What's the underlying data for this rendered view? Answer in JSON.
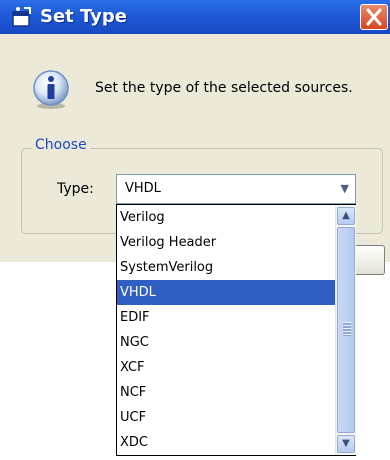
{
  "dialog": {
    "title": "Set Type",
    "message": "Set the type of the selected sources.",
    "group_label": "Choose",
    "type_label": "Type:",
    "selected_type": "VHDL"
  },
  "dropdown": {
    "options": [
      {
        "label": "Verilog"
      },
      {
        "label": "Verilog Header"
      },
      {
        "label": "SystemVerilog"
      },
      {
        "label": "VHDL",
        "selected": true
      },
      {
        "label": "EDIF"
      },
      {
        "label": "NGC"
      },
      {
        "label": "XCF"
      },
      {
        "label": "NCF"
      },
      {
        "label": "UCF"
      },
      {
        "label": "XDC"
      }
    ]
  },
  "colors": {
    "titlebar": "#1f5ad6",
    "selection": "#2f5fc3",
    "group_label": "#1c4bbf"
  },
  "icons": {
    "window": "window-icon",
    "close": "close-icon",
    "info": "info-icon",
    "combo_arrow": "chevron-down-icon"
  }
}
